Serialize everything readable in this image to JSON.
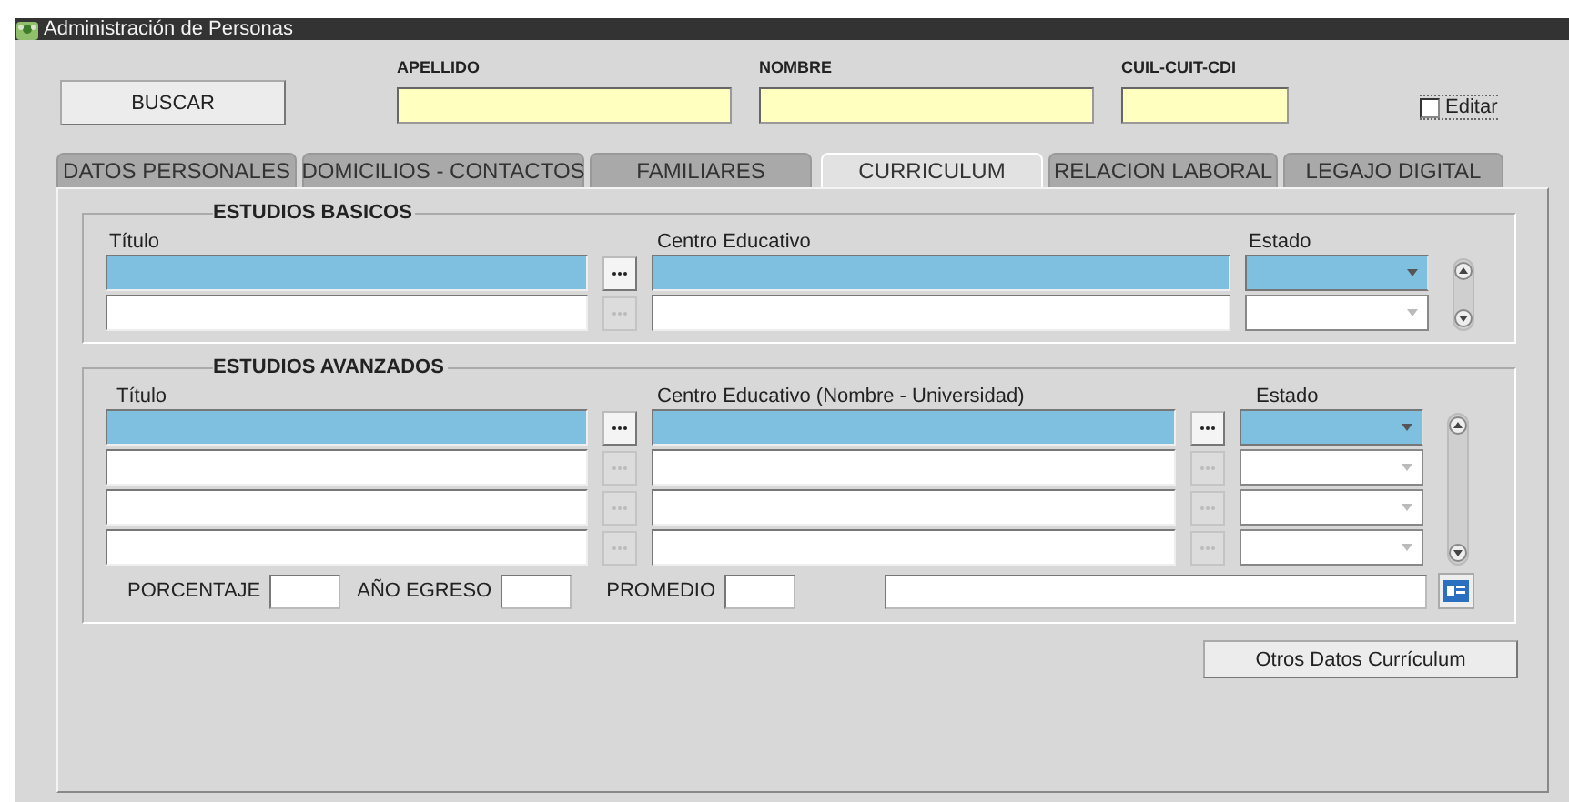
{
  "window": {
    "title": "Administración de Personas"
  },
  "search": {
    "button": "BUSCAR",
    "fields": [
      {
        "label": "APELLIDO"
      },
      {
        "label": "NOMBRE"
      },
      {
        "label": "CUIL-CUIT-CDI"
      }
    ],
    "edit": {
      "label": "Editar",
      "checked": false
    }
  },
  "tabs": [
    {
      "label": "DATOS PERSONALES",
      "selected": false
    },
    {
      "label": "DOMICILIOS - CONTACTOS",
      "selected": false
    },
    {
      "label": "FAMILIARES",
      "selected": false
    },
    {
      "label": "CURRICULUM",
      "selected": true
    },
    {
      "label": "RELACION LABORAL",
      "selected": false
    },
    {
      "label": "LEGAJO DIGITAL",
      "selected": false
    }
  ],
  "groups": [
    {
      "title": "ESTUDIOS BASICOS",
      "columns": [
        "Título",
        "Centro Educativo",
        "Estado"
      ],
      "center_lookup": false,
      "rows": [
        {
          "selected": true
        },
        {
          "selected": false
        }
      ]
    },
    {
      "title": "ESTUDIOS AVANZADOS",
      "columns": [
        "Título",
        "Centro Educativo (Nombre - Universidad)",
        "Estado"
      ],
      "center_lookup": true,
      "rows": [
        {
          "selected": true
        },
        {
          "selected": false
        },
        {
          "selected": false
        },
        {
          "selected": false
        }
      ],
      "footer": [
        {
          "label": "PORCENTAJE"
        },
        {
          "label": "AÑO EGRESO"
        },
        {
          "label": "PROMEDIO"
        }
      ]
    }
  ],
  "other_button": "Otros Datos Currículum"
}
